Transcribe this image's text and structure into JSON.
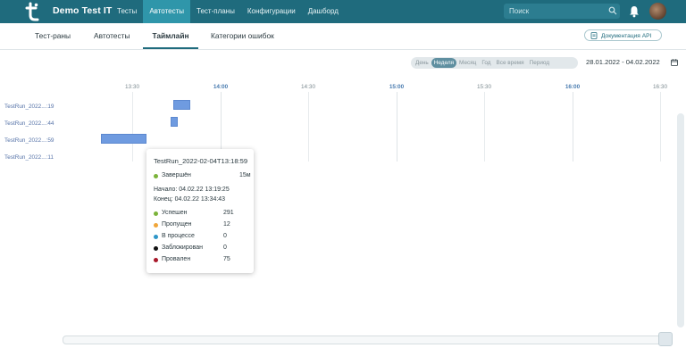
{
  "topbar": {
    "app_name": "Demo Test IT",
    "nav": [
      "Тесты",
      "Автотесты",
      "Тест-планы",
      "Конфигурации",
      "Дашборд"
    ],
    "active_nav": "Автотесты",
    "search_placeholder": "Поиск",
    "colors": {
      "bar": "#1f6b7d",
      "active": "#2f96aa"
    }
  },
  "subnav": {
    "tabs": [
      "Тест-раны",
      "Автотесты",
      "Таймлайн",
      "Категории ошибок"
    ],
    "active_tab": "Таймлайн",
    "doc_button": "Документация API"
  },
  "timeline": {
    "periods": [
      "День",
      "Неделя",
      "Месяц",
      "Год",
      "Все время",
      "Период"
    ],
    "active_period": "Неделя",
    "date_range": "28.01.2022 - 04.02.2022",
    "time_ticks": [
      "13:30",
      "14:00",
      "14:30",
      "15:00",
      "15:30",
      "16:00",
      "16:30"
    ],
    "runs": [
      "TestRun_2022...:19",
      "TestRun_2022...:44",
      "TestRun_2022...:59",
      "TestRun_2022...:11"
    ]
  },
  "tooltip": {
    "title": "TestRun_2022-02-04T13:18:59",
    "status": "Завершён",
    "duration": "15м",
    "start": "Начало: 04.02.22 13:19:25",
    "end": "Конец: 04.02.22 13:34:43",
    "stats": [
      {
        "label": "Успешен",
        "value": "291",
        "color": "#7bb33a"
      },
      {
        "label": "Пропущен",
        "value": "12",
        "color": "#f0a63a"
      },
      {
        "label": "В процессе",
        "value": "0",
        "color": "#2f96c8"
      },
      {
        "label": "Заблокирован",
        "value": "0",
        "color": "#111111"
      },
      {
        "label": "Провален",
        "value": "75",
        "color": "#a8182a"
      }
    ]
  }
}
